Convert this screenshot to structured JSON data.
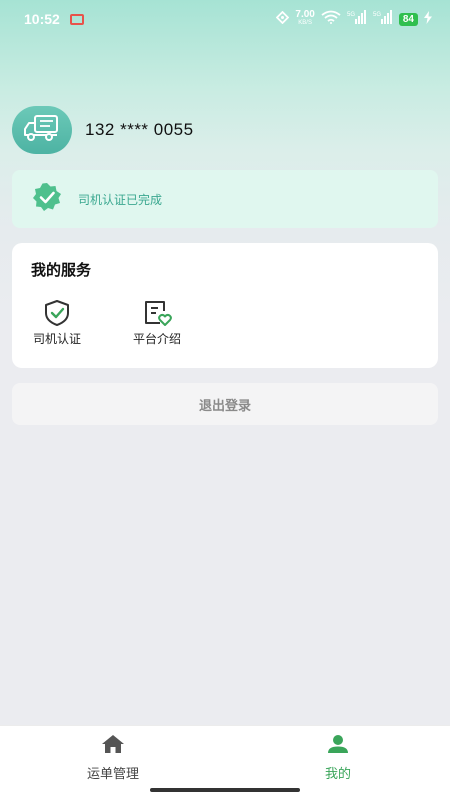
{
  "status_bar": {
    "time": "10:52",
    "net_speed": "7.00",
    "net_unit": "KB/S",
    "battery": "84"
  },
  "profile": {
    "phone": "132 **** 0055",
    "avatar_icon": "truck-icon"
  },
  "certification": {
    "text": "司机认证已完成",
    "icon": "verified-badge-icon",
    "color": "#3ba890"
  },
  "services": {
    "title": "我的服务",
    "items": [
      {
        "label": "司机认证",
        "icon": "shield-check-icon"
      },
      {
        "label": "平台介绍",
        "icon": "platform-intro-icon"
      }
    ]
  },
  "logout": {
    "label": "退出登录"
  },
  "tabbar": {
    "items": [
      {
        "label": "运单管理",
        "icon": "home-icon",
        "active": false
      },
      {
        "label": "我的",
        "icon": "person-icon",
        "active": true
      }
    ],
    "active_color": "#3aa55a"
  }
}
